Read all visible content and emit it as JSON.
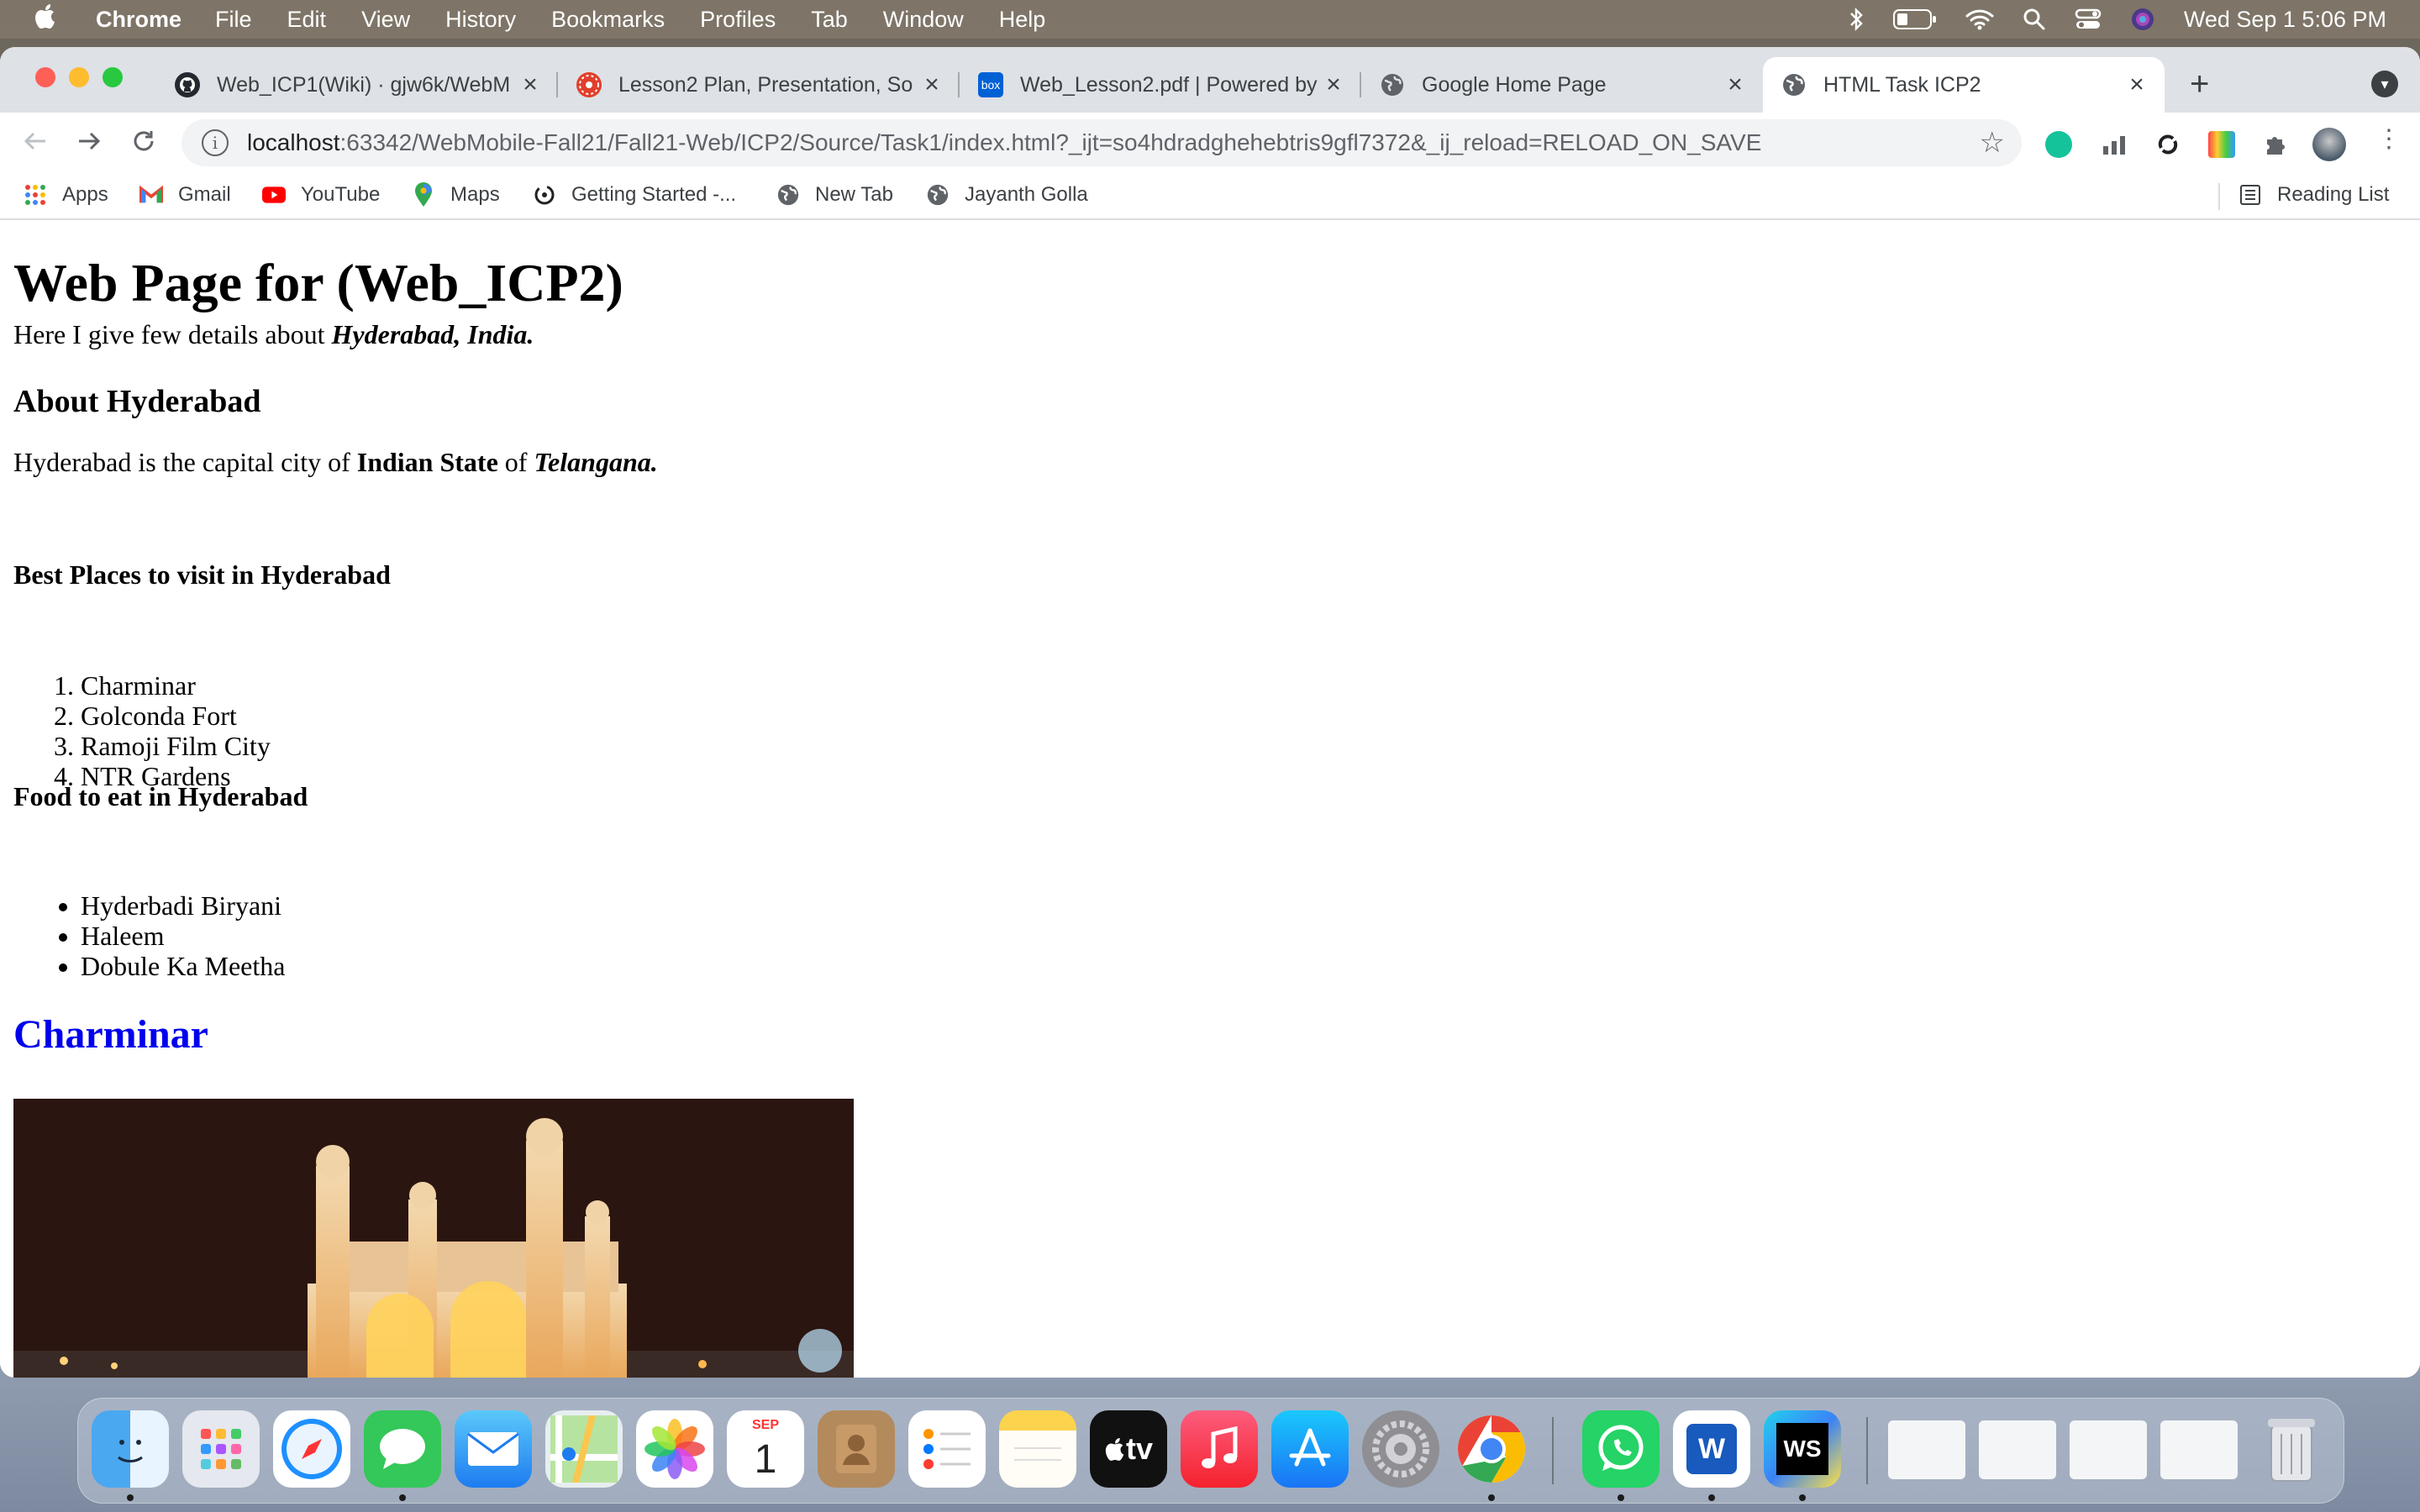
{
  "menubar": {
    "app": "Chrome",
    "items": [
      "File",
      "Edit",
      "View",
      "History",
      "Bookmarks",
      "Profiles",
      "Tab",
      "Window",
      "Help"
    ],
    "clock": "Wed Sep 1  5:06 PM"
  },
  "tabs": [
    {
      "title": "Web_ICP1(Wiki) · gjw6k/WebM",
      "icon": "github-icon"
    },
    {
      "title": "Lesson2 Plan, Presentation, So",
      "icon": "canvas-icon"
    },
    {
      "title": "Web_Lesson2.pdf | Powered by",
      "icon": "box-icon"
    },
    {
      "title": "Google Home Page",
      "icon": "globe-icon"
    },
    {
      "title": "HTML Task ICP2",
      "icon": "globe-icon"
    }
  ],
  "address": {
    "host": "localhost",
    "rest": ":63342/WebMobile-Fall21/Fall21-Web/ICP2/Source/Task1/index.html?_ijt=so4hdradghehebtris9gfl7372&_ij_reload=RELOAD_ON_SAVE"
  },
  "bookmarks": {
    "items": [
      "Apps",
      "Gmail",
      "YouTube",
      "Maps",
      "Getting Started -...",
      "New Tab",
      "Jayanth Golla"
    ],
    "reading_list": "Reading List"
  },
  "page": {
    "h1": "Web Page for (Web_ICP2)",
    "intro_prefix": "Here I give few details about ",
    "intro_em": "Hyderabad, India.",
    "about_heading": "About Hyderabad",
    "about_a": "Hyderabad is the capital city of ",
    "about_b": "Indian State",
    "about_c": " of ",
    "about_d": "Telangana.",
    "places_heading": "Best Places to visit in Hyderabad",
    "places": [
      "Charminar",
      "Golconda Fort",
      "Ramoji Film City",
      "NTR Gardens"
    ],
    "food_heading": "Food to eat in Hyderabad",
    "foods": [
      "Hyderbadi Biryani",
      "Haleem",
      "Dobule Ka Meetha"
    ],
    "link_heading": "Charminar"
  },
  "dock": {
    "calendar_month": "SEP",
    "calendar_day": "1",
    "tv_label": "tv",
    "word_label": "W",
    "ws_label": "WS"
  },
  "colors": {
    "link": "#0000ee",
    "tabstrip": "#dee1e6"
  }
}
